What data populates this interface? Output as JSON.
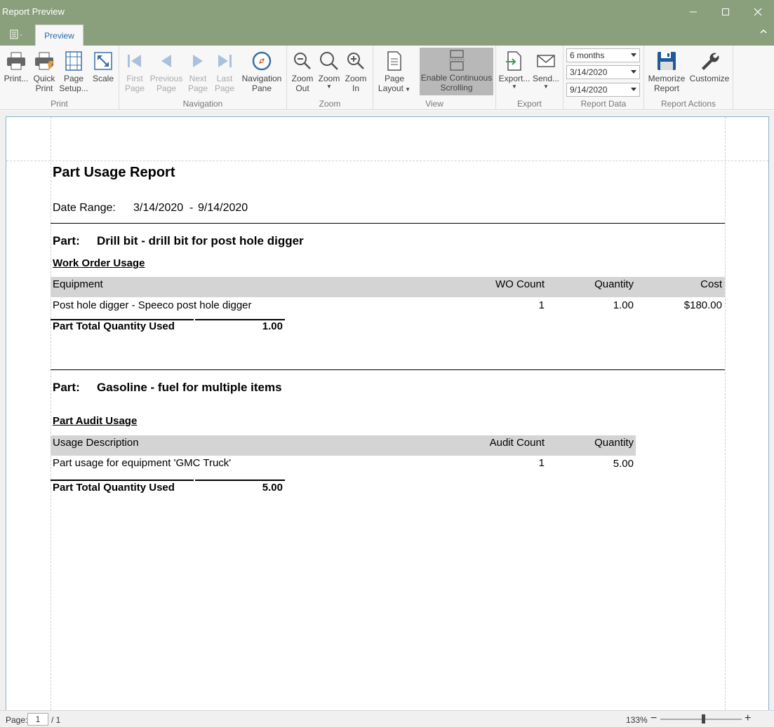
{
  "window": {
    "title": "Report Preview",
    "min_icon": "minimize-icon",
    "max_icon": "maximize-icon",
    "close_icon": "close-icon"
  },
  "tabs": {
    "app_menu_icon": "app-menu-icon",
    "active": "Preview"
  },
  "ribbon": {
    "print": {
      "group_label": "Print",
      "print_label": "Print...",
      "quick_print_line1": "Quick",
      "quick_print_line2": "Print",
      "page_setup_line1": "Page",
      "page_setup_line2": "Setup...",
      "scale_label": "Scale"
    },
    "navigation": {
      "group_label": "Navigation",
      "first_line1": "First",
      "first_line2": "Page",
      "prev_line1": "Previous",
      "prev_line2": "Page",
      "next_line1": "Next",
      "next_line2": "Page",
      "last_line1": "Last",
      "last_line2": "Page",
      "navpane_line1": "Navigation",
      "navpane_line2": "Pane"
    },
    "zoom": {
      "group_label": "Zoom",
      "zoom_out_line1": "Zoom",
      "zoom_out_line2": "Out",
      "zoom_label": "Zoom",
      "zoom_in_line1": "Zoom",
      "zoom_in_line2": "In"
    },
    "view": {
      "page_layout_line1": "Page",
      "page_layout_line2": "Layout",
      "continuous_line1": "Enable Continuous",
      "continuous_line2": "Scrolling",
      "group_label": "View"
    },
    "export": {
      "group_label": "Export",
      "export_label": "Export...",
      "send_label": "Send..."
    },
    "report_data": {
      "group_label": "Report Data",
      "period": "6 months",
      "from_date": "3/14/2020",
      "to_date": "9/14/2020"
    },
    "report_actions": {
      "group_label": "Report Actions",
      "memorize_line1": "Memorize",
      "memorize_line2": "Report",
      "customize_label": "Customize"
    }
  },
  "report": {
    "title": "Part Usage Report",
    "date_range_label": "Date Range:",
    "date_from": "3/14/2020",
    "date_sep": "-",
    "date_to": "9/14/2020",
    "parts": [
      {
        "label": "Part:",
        "name": "Drill bit - drill bit for post hole digger",
        "section": "Work Order Usage",
        "columns": [
          "Equipment",
          "WO Count",
          "Quantity",
          "Cost"
        ],
        "rows": [
          [
            "Post hole digger - Speeco post hole digger",
            "1",
            "1.00",
            "$180.00"
          ]
        ],
        "total_label": "Part Total Quantity Used",
        "total_value": "1.00"
      },
      {
        "label": "Part:",
        "name": "Gasoline - fuel for multiple items",
        "section": "Part Audit Usage",
        "columns": [
          "Usage Description",
          "Audit Count",
          "Quantity"
        ],
        "rows": [
          [
            "Part usage for equipment 'GMC Truck'",
            "1",
            "5.00"
          ]
        ],
        "total_label": "Part Total Quantity Used",
        "total_value": "5.00"
      }
    ]
  },
  "status": {
    "page_label": "Page:",
    "page_current": "1",
    "page_total": "/ 1",
    "zoom": "133%",
    "zoom_minus": "−",
    "zoom_plus": "+"
  }
}
